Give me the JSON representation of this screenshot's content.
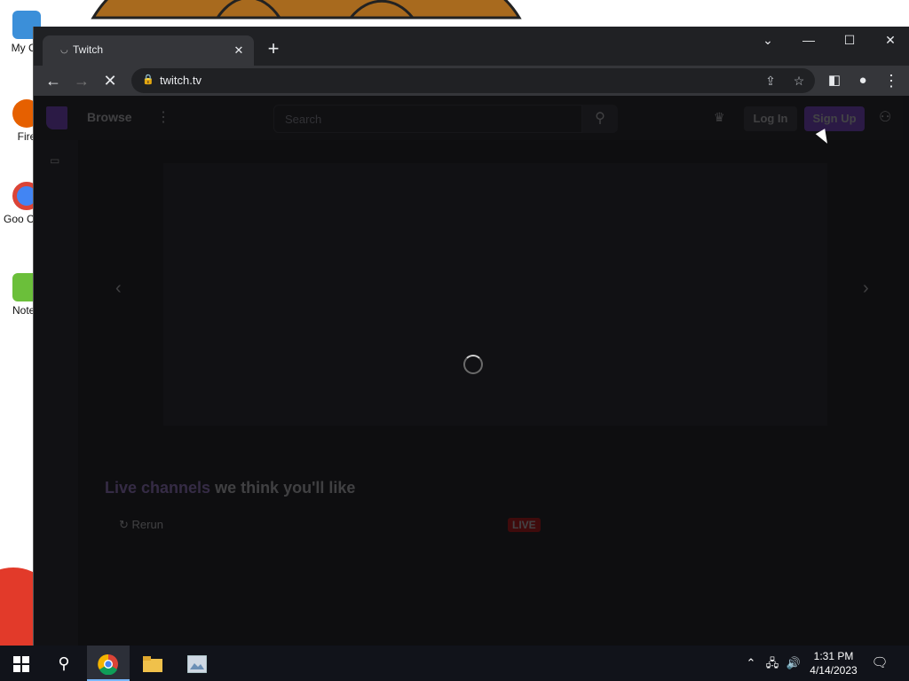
{
  "desktop": {
    "icons": [
      {
        "label": "My Co"
      },
      {
        "label": "Fire"
      },
      {
        "label": "Goo Chro"
      },
      {
        "label": "Notep"
      }
    ]
  },
  "browser": {
    "tab": {
      "title": "Twitch"
    },
    "new_tab_icon": "+",
    "window_controls": {
      "dropdown": "⌄",
      "minimize": "—",
      "maximize": "☐",
      "close": "✕"
    },
    "address": {
      "url": "twitch.tv"
    }
  },
  "page": {
    "nav": {
      "browse": "Browse",
      "search_placeholder": "Search",
      "login": "Log In",
      "signup": "Sign Up"
    },
    "section": {
      "title_prefix": "Live channels",
      "title_rest": " we think you'll like"
    },
    "rerun": "Rerun",
    "live_badge": "LIVE",
    "loading": true
  },
  "taskbar": {
    "clock": {
      "time": "1:31 PM",
      "date": "4/14/2023"
    }
  },
  "colors": {
    "twitch_purple": "#9147ff",
    "chrome_dark": "#202124",
    "taskbar": "#11131a"
  }
}
